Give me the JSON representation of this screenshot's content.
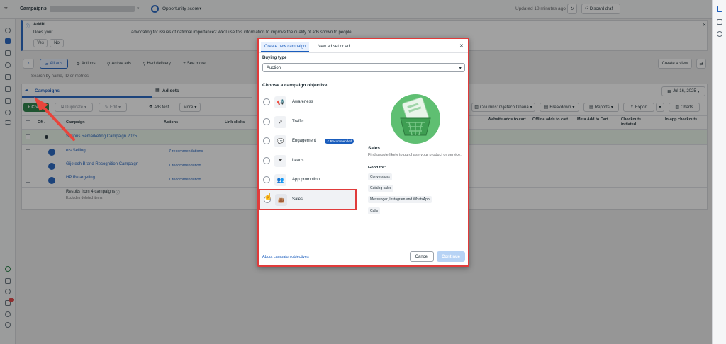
{
  "topbar": {
    "title": "Campaigns",
    "opportunity_score": "Opportunity score",
    "updated": "Updated 18 minutes ago",
    "discard": "Discard draf"
  },
  "banner": {
    "title": "Additi",
    "text_start": "Does your",
    "text_end": "advocating for issues of national importance? We'll use this information to improve the quality of ads shown to people.",
    "yes": "Yes",
    "no": "No"
  },
  "filters": {
    "all_ads": "All ads",
    "actions": "Actions",
    "active_ads": "Active ads",
    "had_delivery": "Had delivery",
    "see_more": "See more",
    "create_view": "Create a view",
    "search_placeholder": "Search by name, ID or metrics"
  },
  "tabs": {
    "campaigns": "Campaigns",
    "ad_sets": "Ad sets",
    "date": "Jul 16, 2025"
  },
  "toolbar": {
    "create": "Create",
    "duplicate": "Duplicate",
    "edit": "Edit",
    "ab_test": "A/B test",
    "more": "More",
    "columns": "Columns: Gijetech Ghana",
    "breakdown": "Breakdown",
    "reports": "Reports",
    "export": "Export",
    "charts": "Charts"
  },
  "table": {
    "headers": {
      "off_on": "Off /",
      "campaign": "Campaign",
      "actions": "Actions",
      "link_clicks": "Link clicks",
      "website_adds": "Website adds to cart",
      "offline_adds": "Offline adds to cart",
      "meta_add": "Meta Add to Cart",
      "checkouts": "Checkouts initiated",
      "inapp": "In-app checkouts..."
    },
    "rows": [
      {
        "name": "Serious Remarketing Campaign 2025",
        "rec": ""
      },
      {
        "name": "ets Selling",
        "rec": "7 recommendations"
      },
      {
        "name": "Gijetech Brand Recognition Campaign",
        "rec": "1 recommendation"
      },
      {
        "name": "HP Retargeting",
        "rec": "1 recommendation"
      }
    ],
    "results": "Results from 4 campaigns",
    "results_sub": "Excludes deleted items"
  },
  "modal": {
    "tab_create": "Create new campaign",
    "tab_new": "New ad set or ad",
    "buying_type_label": "Buying type",
    "buying_type_value": "Auction",
    "objective_heading": "Choose a campaign objective",
    "objectives": [
      {
        "label": "Awareness",
        "icon": "megaphone-icon"
      },
      {
        "label": "Traffic",
        "icon": "cursor-icon"
      },
      {
        "label": "Engagement",
        "icon": "chat-icon"
      },
      {
        "label": "Leads",
        "icon": "funnel-icon"
      },
      {
        "label": "App promotion",
        "icon": "people-icon"
      },
      {
        "label": "Sales",
        "icon": "bag-icon"
      }
    ],
    "recommended": "Recommended",
    "detail_title": "Sales",
    "detail_desc": "Find people likely to purchase your product or service.",
    "good_for": "Good for:",
    "good_for_items": [
      "Conversions",
      "Catalog sales",
      "Messenger, Instagram and WhatsApp",
      "Calls"
    ],
    "about_link": "About campaign objectives",
    "cancel": "Cancel",
    "continue": "Continue"
  },
  "colors": {
    "accent": "#1a5dbd",
    "highlight": "#e03b3b",
    "create_green": "#1f7a3e",
    "illustration_green": "#5fbf72"
  }
}
